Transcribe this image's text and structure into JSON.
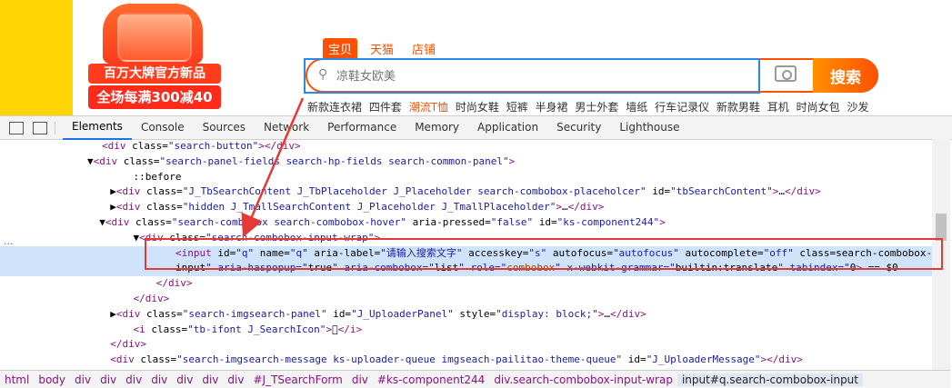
{
  "site": {
    "promo": {
      "line1": "百万大牌官方新品",
      "line2": "全场每满300减40"
    },
    "tabs": [
      {
        "label": "宝贝",
        "active": true
      },
      {
        "label": "天猫",
        "active": false
      },
      {
        "label": "店铺",
        "active": false
      }
    ],
    "search": {
      "placeholder": "凉鞋女欧美",
      "button_label": "搜索"
    },
    "hotwords": [
      {
        "text": "新款连衣裙",
        "highlight": false
      },
      {
        "text": "四件套",
        "highlight": false
      },
      {
        "text": "潮流T恤",
        "highlight": true
      },
      {
        "text": "时尚女鞋",
        "highlight": false
      },
      {
        "text": "短裤",
        "highlight": false
      },
      {
        "text": "半身裙",
        "highlight": false
      },
      {
        "text": "男士外套",
        "highlight": false
      },
      {
        "text": "墙纸",
        "highlight": false
      },
      {
        "text": "行车记录仪",
        "highlight": false
      },
      {
        "text": "新款男鞋",
        "highlight": false
      },
      {
        "text": "耳机",
        "highlight": false
      },
      {
        "text": "时尚女包",
        "highlight": false
      },
      {
        "text": "沙发",
        "highlight": false
      }
    ],
    "colors": {
      "accent": "#ff5000",
      "highlight_blue": "#2a89e8",
      "annotation_red": "#e53935"
    }
  },
  "devtools": {
    "tabs": [
      "Elements",
      "Console",
      "Sources",
      "Network",
      "Performance",
      "Memory",
      "Application",
      "Security",
      "Lighthouse"
    ],
    "active_tab": "Elements",
    "lines": [
      "<div class=\"search-button\"></div>",
      "▼<div class=\"search-panel-fields search-hp-fields search-common-panel\">",
      "    ::before",
      "  ▶<div class=\"J_TbSearchContent J_TbPlaceholder J_Placeholder search-combobox-placeholcer\" id=\"tbSearchContent\">…</div>",
      "  ▶<div class=\"hidden J_TmallSearchContent J_Placeholder J_TmallPlaceholder\">…</div>",
      "  ▼<div class=\"search-combobox search-combobox-hover\" aria-pressed=\"false\" id=\"ks-component244\">",
      "    ▼<div class=\"search-combobox-input-wrap\">",
      "        <input id=\"q\" name=\"q\" aria-label=\"请输入搜索文字\" accesskey=\"s\" autofocus=\"autofocus\" autocomplete=\"off\" class=\"search-combobox-",
      "        input\" aria-haspopup=\"true\" aria-combobox=\"list\" role=\"combobox\" x-webkit-grammar=\"builtin:translate\" tabindex=\"0\"> == $0",
      "      </div>",
      "    </div>",
      "  ▶<div class=\"search-imgsearch-panel\" id=\"J_UploaderPanel\" style=\"display: block;\">…</div>",
      "    <i class=\"tb-ifont J_SearchIcon\">󰄭</i>",
      "  </div>",
      "  <div class=\"search-imgsearch-message ks-uploader-queue imgseach-pailitao-theme-queue\" id=\"J_UploaderMessage\"></div>"
    ],
    "breadcrumbs": [
      "html",
      "body",
      "div",
      "div",
      "div",
      "div",
      "div",
      "div",
      "div",
      "#J_TSearchForm",
      "div",
      "#ks-component244",
      "div.search-combobox-input-wrap",
      "input#q.search-combobox-input"
    ]
  }
}
